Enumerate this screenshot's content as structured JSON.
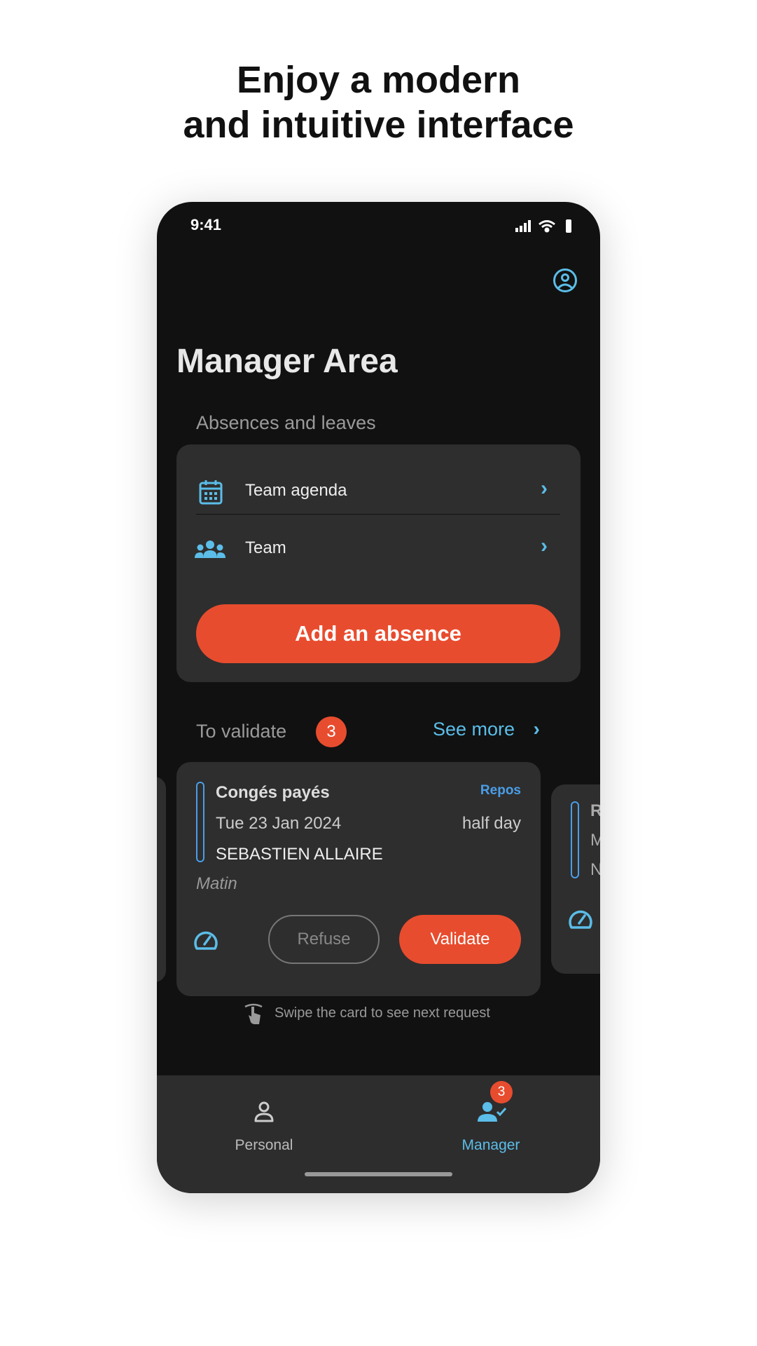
{
  "headline": {
    "line1": "Enjoy a modern",
    "line2": "and intuitive interface"
  },
  "status_bar": {
    "time": "9:41",
    "icons": [
      "signal-icon",
      "wifi-icon",
      "battery-icon"
    ]
  },
  "header": {
    "profile_icon": "user-circle-icon",
    "title": "Manager Area"
  },
  "absences": {
    "section_label": "Absences and leaves",
    "items": [
      {
        "label": "Team agenda",
        "icon": "calendar-icon"
      },
      {
        "label": "Team",
        "icon": "team-icon"
      }
    ],
    "add_button": "Add an absence"
  },
  "to_validate": {
    "label": "To validate",
    "count": "3",
    "see_more": "See more",
    "card": {
      "type": "Congés payés",
      "tag": "Repos",
      "date": "Tue 23 Jan 2024",
      "duration": "half day",
      "employee": "SEBASTIEN ALLAIRE",
      "period": "Matin",
      "refuse": "Refuse",
      "validate": "Validate"
    },
    "next_card_partial": [
      "R",
      "M",
      "N"
    ],
    "hint": "Swipe the card to see next request"
  },
  "bottom_nav": {
    "items": [
      {
        "label": "Personal",
        "icon": "person-icon"
      },
      {
        "label": "Manager",
        "icon": "manager-check-icon",
        "badge": "3"
      }
    ]
  },
  "colors": {
    "accent_blue": "#5bbde8",
    "accent_orange": "#e84c2e",
    "tag_blue": "#4a9ee8",
    "background": "#111111",
    "card": "#2e2e2e"
  }
}
